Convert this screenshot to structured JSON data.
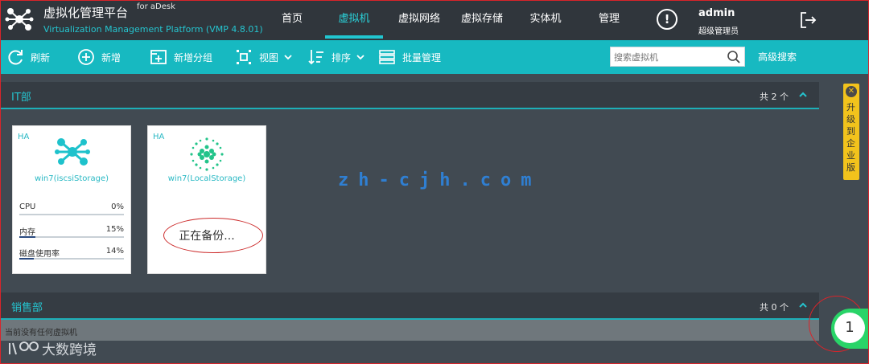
{
  "header": {
    "title": "虚拟化管理平台",
    "for_label": "for aDesk",
    "subtitle": "Virtualization Management Platform (VMP 4.8.01)",
    "nav": [
      {
        "label": "首页"
      },
      {
        "label": "虚拟机"
      },
      {
        "label": "虚拟网络"
      },
      {
        "label": "虚拟存储"
      },
      {
        "label": "实体机"
      },
      {
        "label": "管理"
      }
    ],
    "active_nav": "虚拟机",
    "alert_symbol": "!",
    "user_name": "admin",
    "user_role": "超级管理员"
  },
  "toolbar": {
    "refresh": "刷新",
    "add": "新增",
    "add_group": "新增分组",
    "view": "视图",
    "sort": "排序",
    "batch": "批量管理",
    "search_placeholder": "搜索虚拟机",
    "advanced_search": "高级搜索"
  },
  "groups": [
    {
      "title": "IT部",
      "count": "共 2 个",
      "vms": [
        {
          "badge": "HA",
          "name": "win7(iscsiStorage)",
          "stats": [
            {
              "label": "CPU",
              "value": "0%",
              "fill": 0.0
            },
            {
              "label": "内存",
              "value": "15%",
              "fill": 0.15
            },
            {
              "label": "磁盘使用率",
              "value": "14%",
              "fill": 0.14
            }
          ]
        },
        {
          "badge": "HA",
          "name": "win7(LocalStorage)",
          "status": "正在备份..."
        }
      ]
    },
    {
      "title": "销售部",
      "count": "共 0 个",
      "empty_text": "当前没有任何虚拟机"
    }
  ],
  "upgrade_banner": "升级到企业版",
  "notification_count": "1",
  "watermark": "zh-cjh.com",
  "brand_watermark": "大数跨境",
  "colors": {
    "accent": "#17b9c1",
    "header_bg": "#30363c",
    "content_bg": "#414a52",
    "upgrade": "#f2c31c",
    "badge": "#29d468"
  }
}
